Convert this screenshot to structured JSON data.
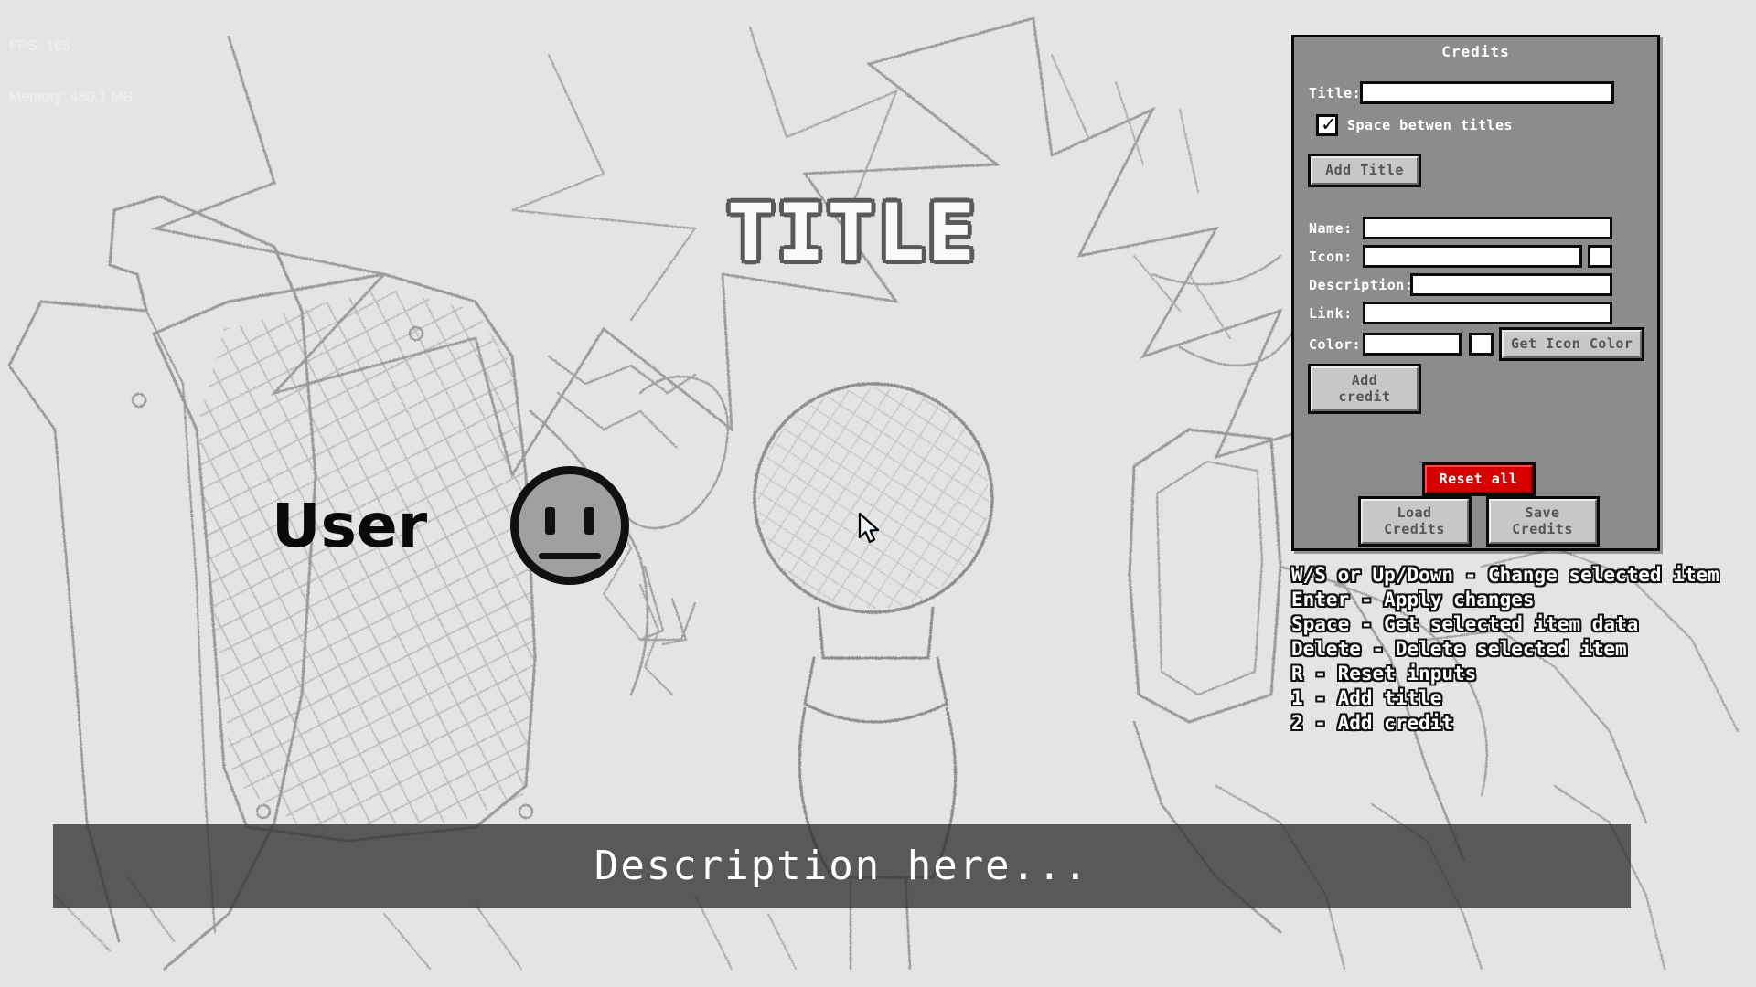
{
  "perf": {
    "fps_label": "FPS: 165",
    "memory_label": "Memory: 450.1 MB"
  },
  "preview": {
    "title_text": "TITLE",
    "credit_name": "User",
    "icon_name": "neutral-face-icon",
    "description_text": "Description here...",
    "icon_color": "#a0a0a0",
    "title_outline_color": "#5a5a5a",
    "description_bar_color": "#323232"
  },
  "panel": {
    "heading": "Credits",
    "accent_danger_color": "#d60000",
    "background_color": "#8c8c8c",
    "title_section": {
      "title_label": "Title:",
      "title_value": "",
      "title_placeholder": "",
      "space_checkbox_label": "Space betwen titles",
      "space_checkbox_checked": true,
      "add_title_label": "Add Title"
    },
    "credit_section": {
      "name_label": "Name:",
      "name_value": "",
      "icon_label": "Icon:",
      "icon_value": "",
      "icon_swatch_color": "#ffffff",
      "description_label": "Description:",
      "description_value": "",
      "link_label": "Link:",
      "link_value": "",
      "color_label": "Color:",
      "color_value": "",
      "color_swatch_color": "#ffffff",
      "get_icon_color_label": "Get Icon Color",
      "add_credit_label": "Add credit"
    },
    "actions": {
      "reset_all_label": "Reset all",
      "load_credits_label": "Load Credits",
      "save_credits_label": "Save Credits"
    }
  },
  "shortcuts": {
    "lines": [
      "W/S or Up/Down - Change selected item",
      "Enter - Apply changes",
      "Space - Get selected item data",
      "Delete - Delete selected item",
      "R - Reset inputs",
      "1 - Add title",
      "2 - Add credit"
    ],
    "text": "W/S or Up/Down - Change selected item\nEnter - Apply changes\nSpace - Get selected item data\nDelete - Delete selected item\nR - Reset inputs\n1 - Add title\n2 - Add credit"
  }
}
